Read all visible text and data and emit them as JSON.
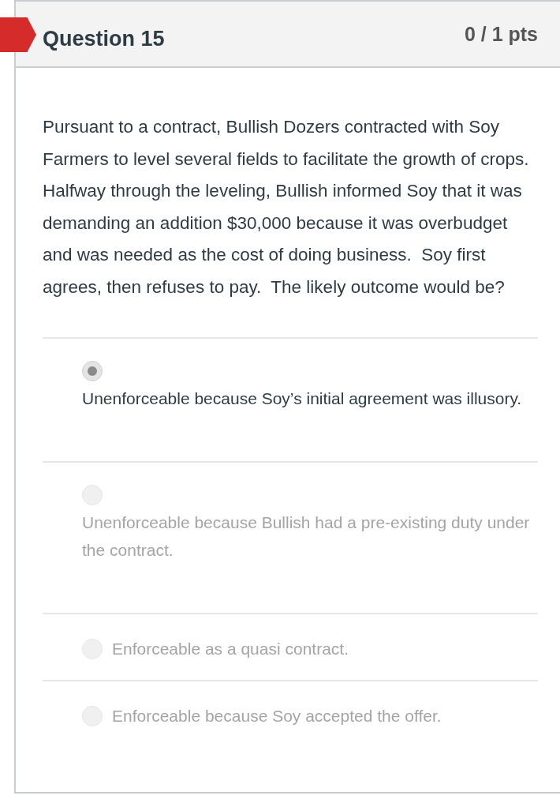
{
  "question": {
    "title": "Question 15",
    "points": "0 / 1 pts",
    "flagged": true,
    "text": "Pursuant to a contract, Bullish Dozers contracted with Soy Farmers to level several fields to facilitate the growth of crops.  Halfway through the leveling, Bullish informed Soy that it was demanding an addition $30,000 because it was overbudget and was needed as the cost of doing business.  Soy first agrees, then refuses to pay.  The likely outcome would be?"
  },
  "answers": [
    {
      "kind": "stacked",
      "label": "Unenforceable because Soy’s initial agreement was illusory.",
      "selected": true
    },
    {
      "kind": "stacked",
      "label": "Unenforceable because Bullish had a pre-existing duty under the contract.",
      "selected": false
    },
    {
      "kind": "inline",
      "label": "Enforceable as a quasi contract.",
      "selected": false
    },
    {
      "kind": "inline",
      "label": "Enforceable because Soy accepted the offer.",
      "selected": false
    }
  ]
}
